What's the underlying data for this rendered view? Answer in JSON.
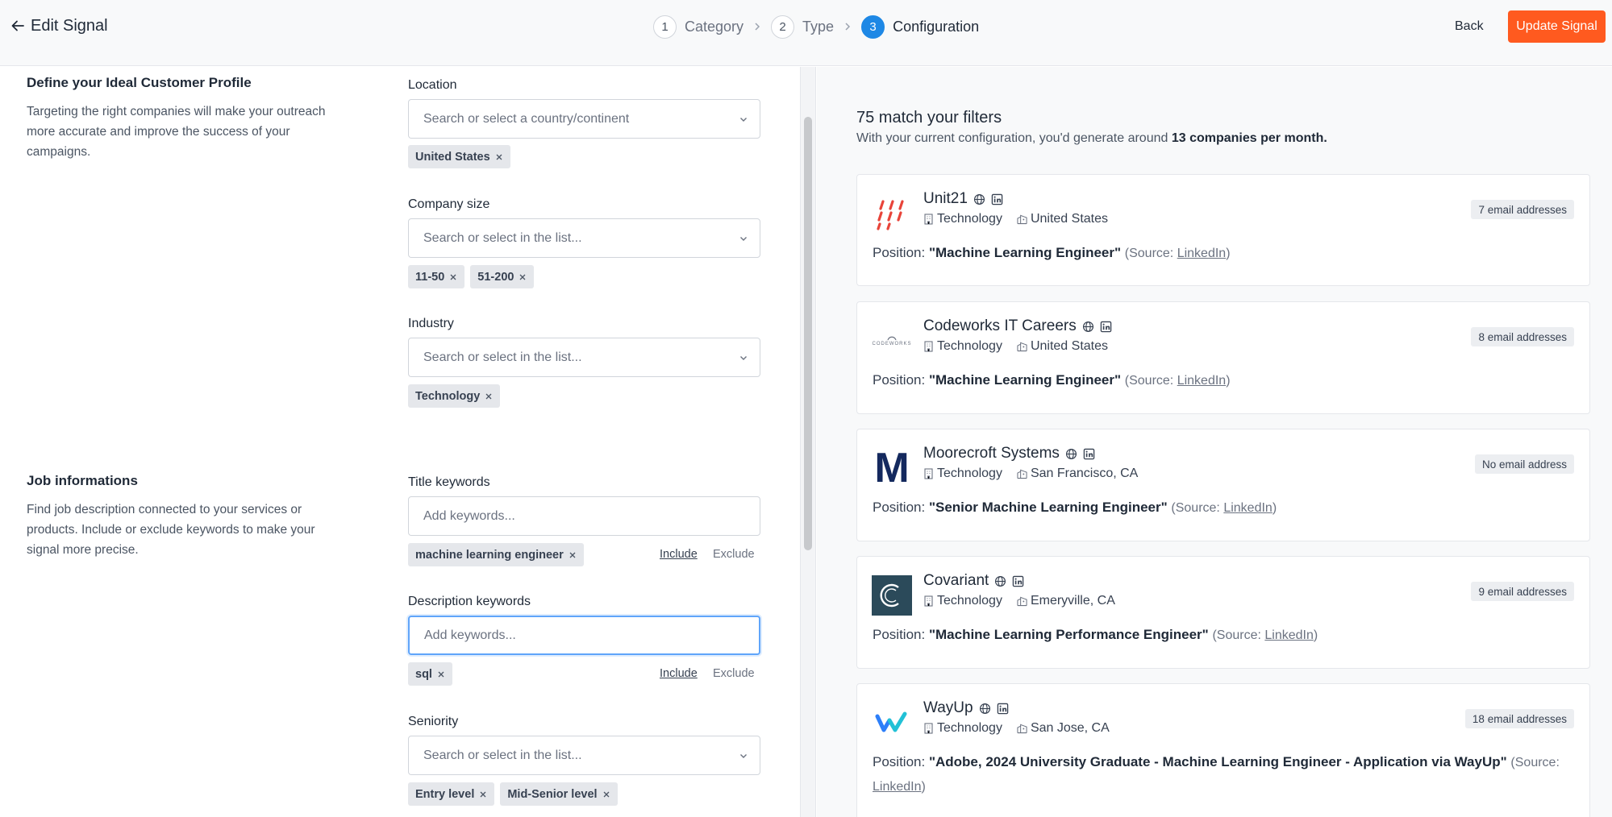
{
  "header": {
    "title": "Edit Signal",
    "steps": [
      {
        "num": "1",
        "label": "Category"
      },
      {
        "num": "2",
        "label": "Type"
      },
      {
        "num": "3",
        "label": "Configuration"
      }
    ],
    "back_label": "Back",
    "update_label": "Update Signal"
  },
  "icp": {
    "title": "Define your Ideal Customer Profile",
    "description": "Targeting the right companies will make your outreach more accurate and improve the success of your campaigns.",
    "location": {
      "label": "Location",
      "placeholder": "Search or select a country/continent",
      "tags": [
        "United States"
      ]
    },
    "company_size": {
      "label": "Company size",
      "placeholder": "Search or select in the list...",
      "tags": [
        "11-50",
        "51-200"
      ]
    },
    "industry": {
      "label": "Industry",
      "placeholder": "Search or select in the list...",
      "tags": [
        "Technology"
      ]
    }
  },
  "job": {
    "title": "Job informations",
    "description": "Find job description connected to your services or products. Include or exclude keywords to make your signal more precise.",
    "title_keywords": {
      "label": "Title keywords",
      "placeholder": "Add keywords...",
      "tags": [
        "machine learning engineer"
      ],
      "include": "Include",
      "exclude": "Exclude"
    },
    "description_keywords": {
      "label": "Description keywords",
      "placeholder": "Add keywords...",
      "tags": [
        "sql"
      ],
      "include": "Include",
      "exclude": "Exclude"
    },
    "seniority": {
      "label": "Seniority",
      "placeholder": "Search or select in the list...",
      "tags": [
        "Entry level",
        "Mid-Senior level"
      ]
    }
  },
  "results": {
    "count_title": "75 match your filters",
    "sub_prefix": "With your current configuration, you'd generate around ",
    "sub_bold": "13 companies per month.",
    "position_prefix": "Position: ",
    "source_prefix": "(Source: ",
    "source_link": "LinkedIn",
    "source_suffix": ")",
    "companies": [
      {
        "name": "Unit21",
        "industry": "Technology",
        "location": "United States",
        "emails": "7 email addresses",
        "position": "\"Machine Learning Engineer\""
      },
      {
        "name": "Codeworks IT Careers",
        "industry": "Technology",
        "location": "United States",
        "emails": "8 email addresses",
        "position": "\"Machine Learning Engineer\"",
        "logo_text": "CODEWORKS"
      },
      {
        "name": "Moorecroft Systems",
        "industry": "Technology",
        "location": "San Francisco, CA",
        "emails": "No email address",
        "position": "\"Senior Machine Learning Engineer\"",
        "logo_text": "M"
      },
      {
        "name": "Covariant",
        "industry": "Technology",
        "location": "Emeryville, CA",
        "emails": "9 email addresses",
        "position": "\"Machine Learning Performance Engineer\""
      },
      {
        "name": "WayUp",
        "industry": "Technology",
        "location": "San Jose, CA",
        "emails": "18 email addresses",
        "position": "\"Adobe, 2024 University Graduate - Machine Learning Engineer - Application via WayUp\""
      }
    ]
  },
  "colors": {
    "accent": "#1e88e5",
    "cta": "#ff5a1f",
    "unit21": "#e8443a",
    "moorecroft": "#14295e",
    "covariant": "#2b4a5a",
    "wayup_a": "#2d7ff9",
    "wayup_b": "#22c1d6"
  }
}
